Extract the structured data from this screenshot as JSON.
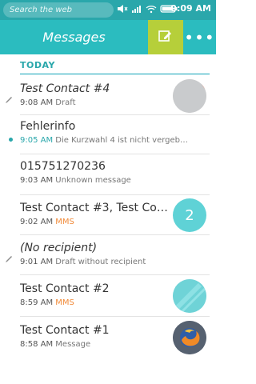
{
  "status": {
    "search_placeholder": "Search the web",
    "time": "9:09 AM"
  },
  "header": {
    "title": "Messages"
  },
  "section": {
    "today_label": "TODAY"
  },
  "threads": [
    {
      "name": "Test Contact #4",
      "time": "9:08 AM",
      "detail": "Draft",
      "italic_name": true
    },
    {
      "name": "Fehlerinfo",
      "time": "9:05 AM",
      "detail": "Die Kurzwahl 4 ist nicht vergeb…",
      "unread": true
    },
    {
      "name": "015751270236",
      "time": "9:03 AM",
      "detail": "Unknown message"
    },
    {
      "name": "Test Contact #3, Test Cont…",
      "time": "9:02 AM",
      "detail": "MMS",
      "badge": "2"
    },
    {
      "name": "(No recipient)",
      "time": "9:01 AM",
      "detail": "Draft without recipient",
      "italic_name": true
    },
    {
      "name": "Test Contact #2",
      "time": "8:59 AM",
      "detail": "MMS"
    },
    {
      "name": "Test Contact #1",
      "time": "8:58 AM",
      "detail": "Message"
    }
  ],
  "colors": {
    "statusbar": "#2aa7ab",
    "header": "#2bbcbf",
    "compose_bg": "#b6cf3a",
    "accent": "#2aa7ab",
    "mms": "#f18b3a"
  }
}
